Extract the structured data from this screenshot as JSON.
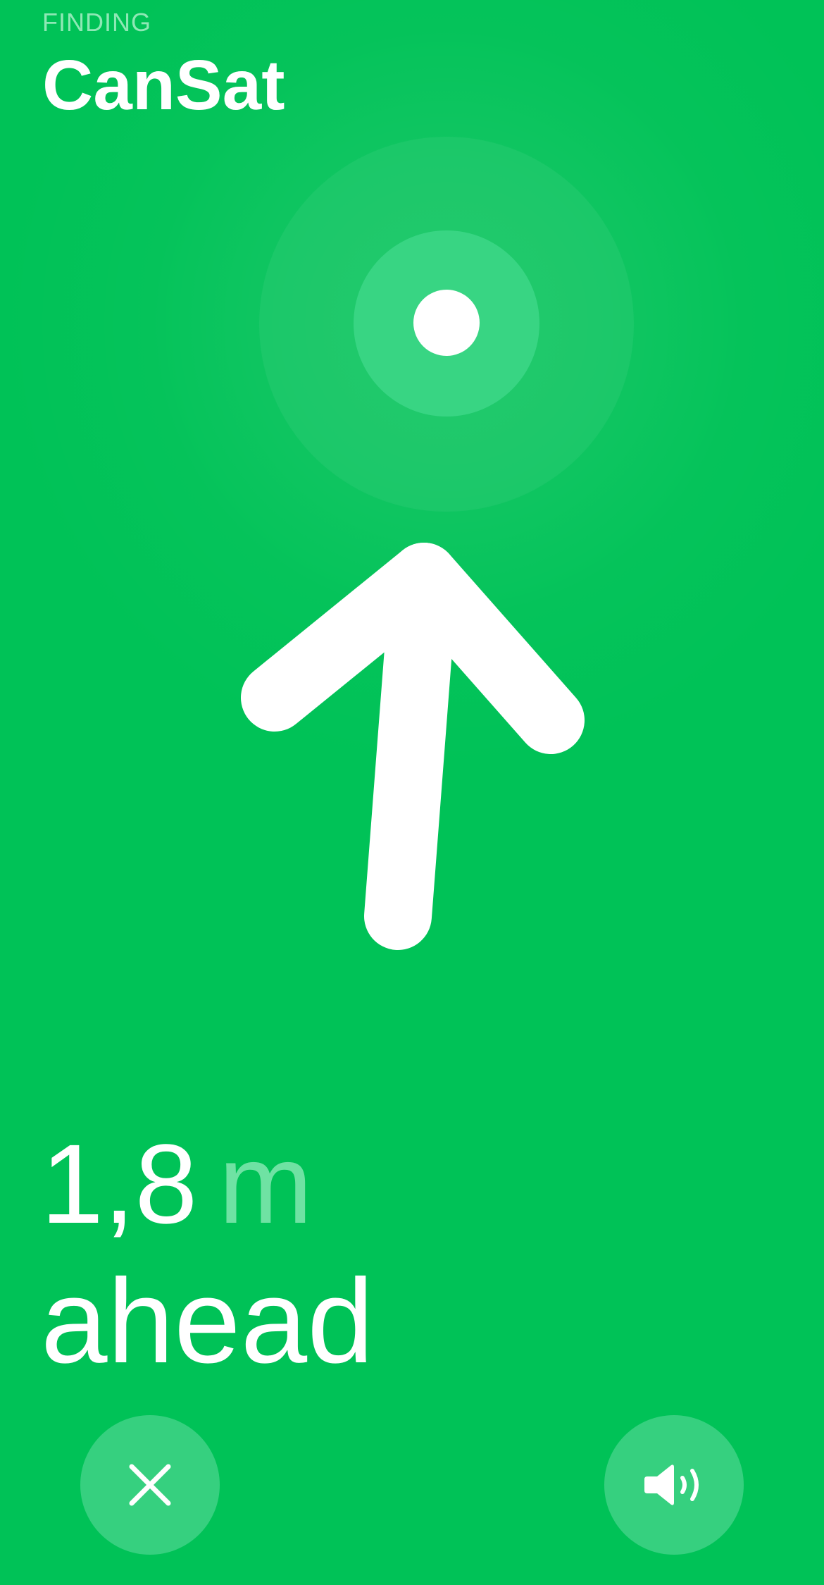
{
  "header": {
    "status_label": "FINDING",
    "item_name": "CanSat"
  },
  "distance": {
    "value": "1,8",
    "unit": "m",
    "direction": "ahead"
  },
  "controls": {
    "close_icon": "close-icon",
    "sound_icon": "speaker-icon"
  },
  "colors": {
    "background": "#00c257",
    "accent_light": "#36d07f",
    "unit_text": "#6fe2a3",
    "foreground": "#ffffff"
  }
}
